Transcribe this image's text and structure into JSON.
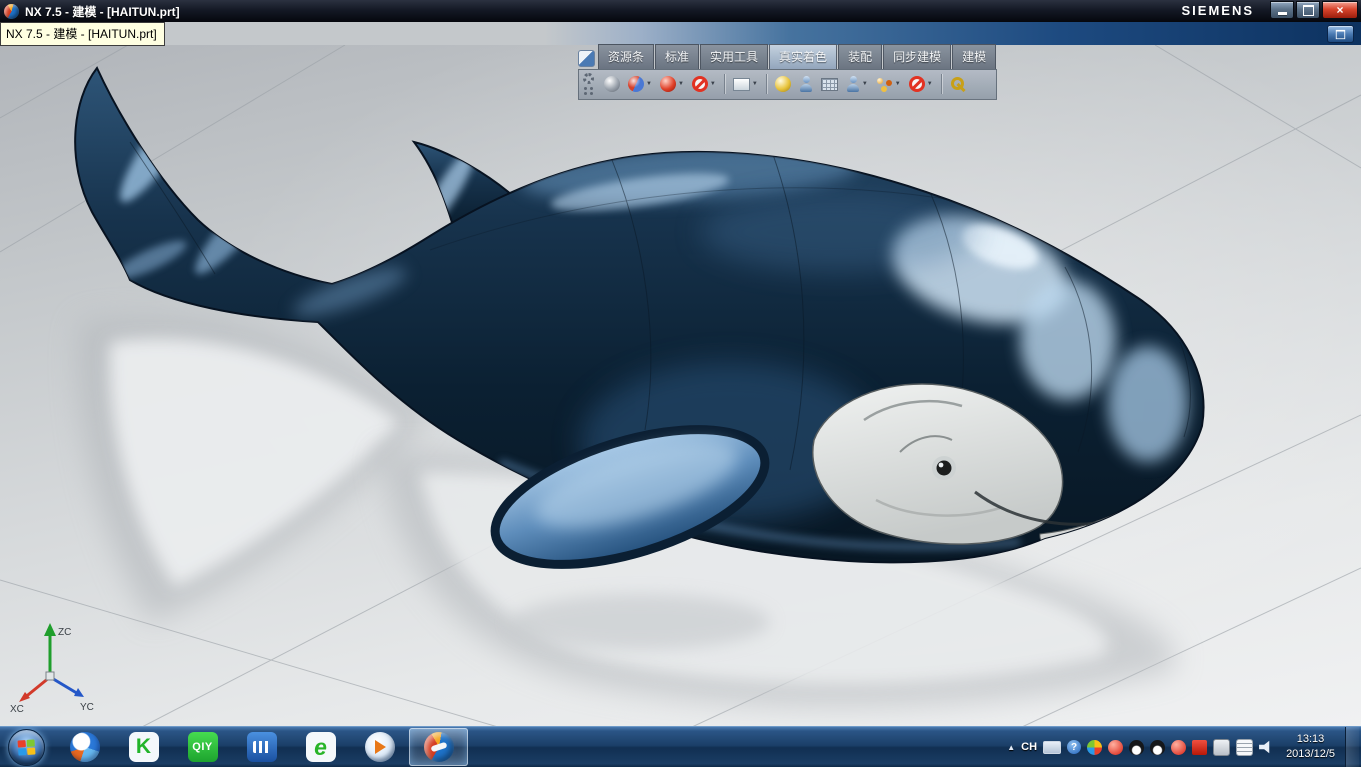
{
  "titlebar": {
    "title": "NX 7.5 - 建模 - [HAITUN.prt]",
    "brand": "SIEMENS",
    "close_glyph": "×"
  },
  "tooltip": {
    "text": "NX 7.5 - 建模 - [HAITUN.prt]"
  },
  "ribbon": {
    "caret": "▼",
    "tabs": [
      {
        "label": "资源条",
        "active": false
      },
      {
        "label": "标准",
        "active": false
      },
      {
        "label": "实用工具",
        "active": false
      },
      {
        "label": "真实着色",
        "active": true
      },
      {
        "label": "装配",
        "active": false
      },
      {
        "label": "同步建模",
        "active": false
      },
      {
        "label": "建模",
        "active": false
      }
    ],
    "buttons": [
      "gear",
      "shaded-sphere",
      "half-shaded-sphere",
      "red-sphere",
      "no-shade",
      "face-analysis",
      "art-shade",
      "person",
      "mesh",
      "person-pose",
      "sphere-group",
      "disable",
      "wrench"
    ]
  },
  "viewport": {
    "document": "HAITUN.prt",
    "model": "shaded dolphin 3D model with floor reflection",
    "triad": {
      "x": "XC",
      "y": "YC",
      "z": "ZC"
    }
  },
  "taskbar": {
    "apps": [
      {
        "name": "browser-ball",
        "label": ""
      },
      {
        "name": "kugou",
        "label": "K"
      },
      {
        "name": "iqiyi",
        "label": "QIY"
      },
      {
        "name": "video-player",
        "label": ""
      },
      {
        "name": "green-e-browser",
        "label": "e"
      },
      {
        "name": "media-player",
        "label": ""
      },
      {
        "name": "nx",
        "label": "",
        "active": true
      }
    ],
    "tray": {
      "hidden_arrow": "▲",
      "language": "CH",
      "help_glyph": "?",
      "icons": [
        "color-wheel",
        "antivirus",
        "qq",
        "qq-2",
        "download",
        "flag",
        "printer",
        "notepad",
        "volume"
      ],
      "time": "13:13",
      "date": "2013/12/5"
    }
  },
  "colors": {
    "title_bg": "#10141c",
    "taskbar_blue": "#1b3f68",
    "dolphin_body": "#0b2032",
    "dolphin_highlight": "#cfe4f5",
    "flipper": "#5e8dbb",
    "viewport_top": "#b1b5ba",
    "viewport_bottom": "#f0f1f2",
    "tooltip_bg": "#ffffe1"
  }
}
